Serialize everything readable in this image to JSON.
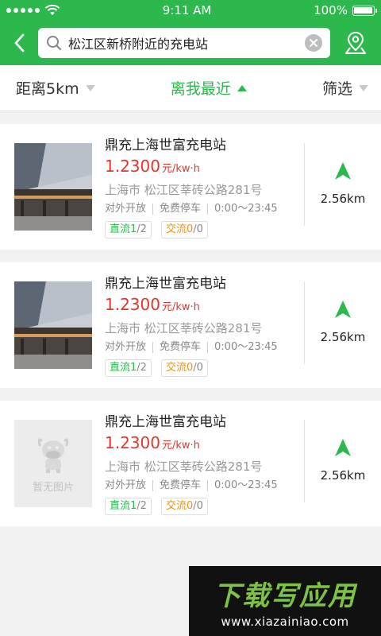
{
  "status_bar": {
    "time": "9:11 AM",
    "battery": "100%"
  },
  "search": {
    "query": "松江区新桥附近的充电站"
  },
  "filters": [
    {
      "label": "距离5km",
      "active": false
    },
    {
      "label": "离我最近",
      "active": true
    },
    {
      "label": "筛选",
      "active": false
    }
  ],
  "stations": [
    {
      "name": "鼎充上海世富充电站",
      "price": "1.2300",
      "unit": "元/kw·h",
      "address": "上海市 松江区莘砖公路281号",
      "access": "对外开放",
      "parking": "免费停车",
      "hours": "0:00～23:45",
      "dc_label": "直流",
      "dc_available": "1",
      "dc_total": "/2",
      "ac_label": "交流",
      "ac_available": "0",
      "ac_total": "/0",
      "distance": "2.56km",
      "has_photo": true
    },
    {
      "name": "鼎充上海世富充电站",
      "price": "1.2300",
      "unit": "元/kw·h",
      "address": "上海市 松江区莘砖公路281号",
      "access": "对外开放",
      "parking": "免费停车",
      "hours": "0:00～23:45",
      "dc_label": "直流",
      "dc_available": "1",
      "dc_total": "/2",
      "ac_label": "交流",
      "ac_available": "0",
      "ac_total": "/0",
      "distance": "2.56km",
      "has_photo": true
    },
    {
      "name": "鼎充上海世富充电站",
      "price": "1.2300",
      "unit": "元/kw·h",
      "address": "上海市 松江区莘砖公路281号",
      "access": "对外开放",
      "parking": "免费停车",
      "hours": "0:00～23:45",
      "dc_label": "直流",
      "dc_available": "1",
      "dc_total": "/2",
      "ac_label": "交流",
      "ac_available": "0",
      "ac_total": "/0",
      "distance": "2.56km",
      "has_photo": false,
      "placeholder_text": "暂无图片"
    }
  ],
  "watermark": {
    "title": "下载写应用",
    "url": "www.xiazainiao.com"
  },
  "colors": {
    "brand": "#2cb84c",
    "price": "#e0362c",
    "ac_tag": "#e8941a"
  }
}
